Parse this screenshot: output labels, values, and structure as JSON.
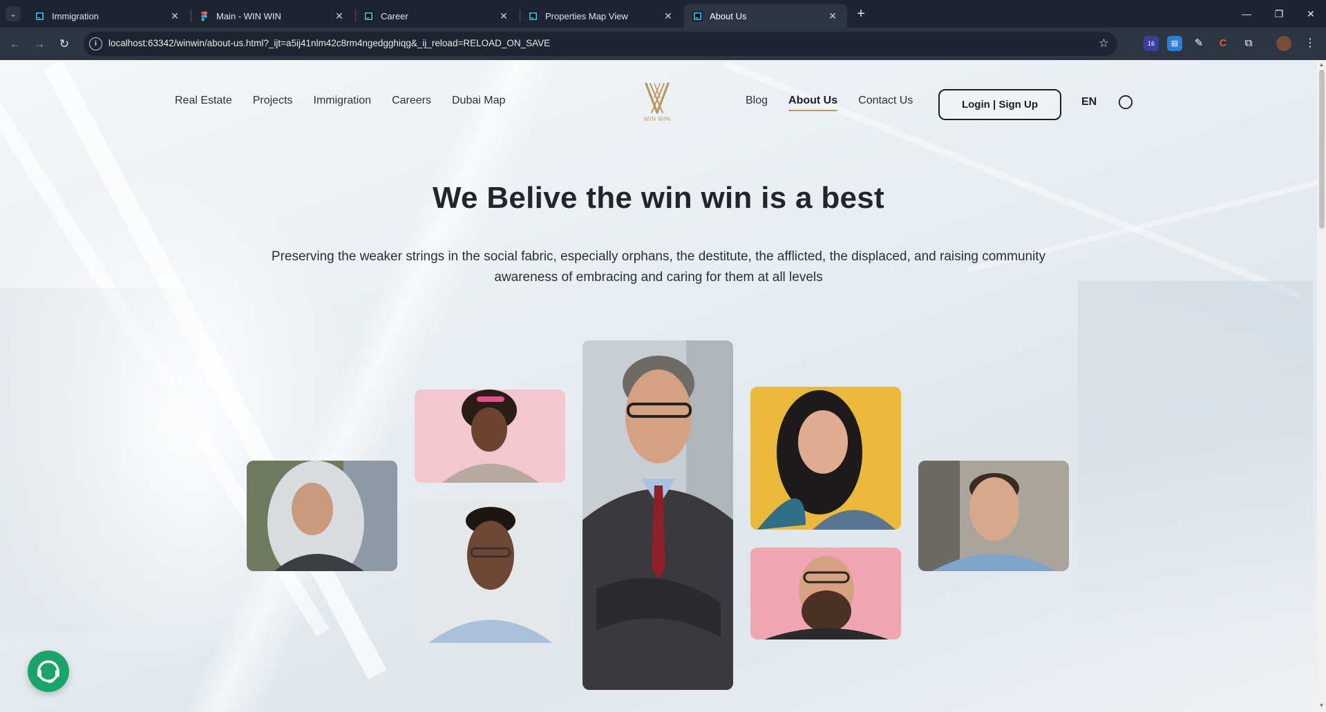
{
  "browser": {
    "tabs": [
      {
        "title": "Immigration",
        "icon": "webstorm-icon"
      },
      {
        "title": "Main - WIN WIN",
        "icon": "figma-icon"
      },
      {
        "title": "Career",
        "icon": "webstorm-icon"
      },
      {
        "title": "Properties Map View",
        "icon": "webstorm-icon"
      },
      {
        "title": "About Us",
        "icon": "webstorm-icon",
        "active": true
      }
    ],
    "new_tab": "+",
    "url": "localhost:63342/winwin/about-us.html?_ijt=a5ij41nlm42c8rm4ngedgghiqg&_ij_reload=RELOAD_ON_SAVE",
    "extension_badge": "16"
  },
  "nav": {
    "left": [
      "Real Estate",
      "Projects",
      "Immigration",
      "Careers",
      "Dubai Map"
    ],
    "right": [
      "Blog",
      "About Us",
      "Contact Us"
    ],
    "active": "About Us",
    "login": "Login | Sign Up",
    "lang": "EN"
  },
  "brand": {
    "logo_text": "WIN WIN",
    "accent": "#b99760"
  },
  "hero": {
    "title": "We Belive the win win is a best",
    "subtitle": "Preserving the weaker strings in the social fabric, especially orphans, the destitute, the afflicted, the displaced, and raising community awareness of embracing and caring for them at all levels"
  },
  "colors": {
    "support": "#1aa36a",
    "chrome_dark": "#1f2530",
    "chrome_mid": "#2e3542"
  }
}
